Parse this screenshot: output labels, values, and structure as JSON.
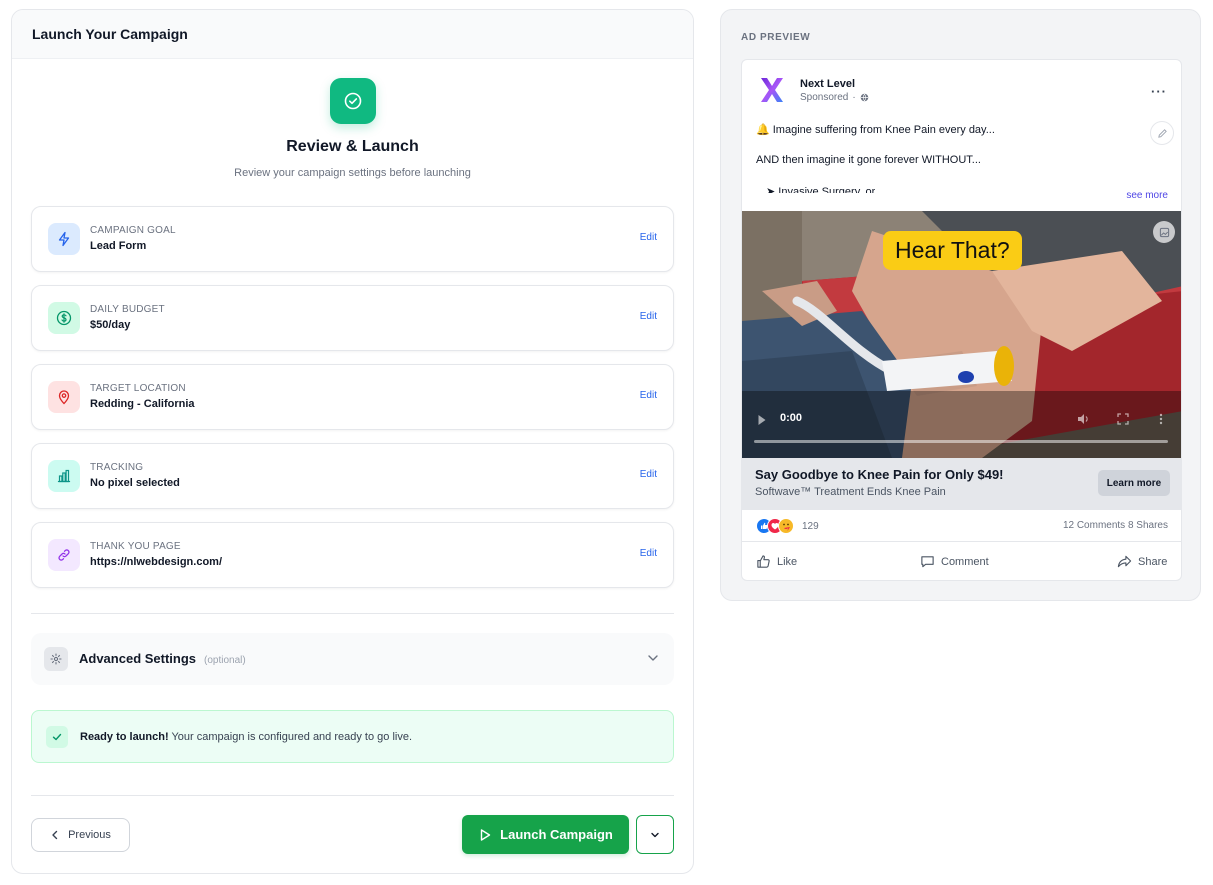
{
  "left": {
    "header_title": "Launch Your Campaign",
    "hero_title": "Review & Launch",
    "hero_subtitle": "Review your campaign settings before launching",
    "summary": [
      {
        "label": "CAMPAIGN GOAL",
        "value": "Lead Form",
        "edit": "Edit",
        "icon": "lightning-icon",
        "color": "#dbeafe"
      },
      {
        "label": "DAILY BUDGET",
        "value": "$50/day",
        "edit": "Edit",
        "icon": "dollar-icon",
        "color": "#d1fae5"
      },
      {
        "label": "TARGET LOCATION",
        "value": "Redding - California",
        "edit": "Edit",
        "icon": "map-pin-icon",
        "color": "#fee2e2"
      },
      {
        "label": "TRACKING",
        "value": "No pixel selected",
        "edit": "Edit",
        "icon": "bar-chart-icon",
        "color": "#ccfbf1"
      },
      {
        "label": "THANK YOU PAGE",
        "value": "https://nlwebdesign.com/",
        "edit": "Edit",
        "icon": "link-icon",
        "color": "#f3e8ff"
      }
    ],
    "advanced": {
      "title": "Advanced Settings",
      "optional": "(optional)"
    },
    "ready": {
      "bold": "Ready to launch!",
      "text": " Your campaign is configured and ready to go live."
    },
    "buttons": {
      "previous": "Previous",
      "launch": "Launch Campaign"
    }
  },
  "preview": {
    "label": "AD PREVIEW",
    "page_name": "Next Level",
    "sponsored": "Sponsored",
    "sponsored_dot": "·",
    "more": "···",
    "text1": "🔔  Imagine suffering from Knee Pain every day...",
    "text2": "AND then imagine it gone forever WITHOUT...",
    "text3": "➤  Invasive Surgery, or",
    "see_more": "see more",
    "video_overlay": "Hear That?",
    "video_time": "0:00",
    "headline": "Say Goodbye to Knee Pain for Only $49!",
    "description": "Softwave™  Treatment Ends Knee Pain",
    "cta": "Learn more",
    "reactions_count": "129",
    "stats": "12 Comments 8 Shares",
    "actions": {
      "like": "Like",
      "comment": "Comment",
      "share": "Share"
    }
  },
  "colors": {
    "accent": "#16a34a",
    "hero": "#10b981",
    "link": "#2563eb"
  }
}
